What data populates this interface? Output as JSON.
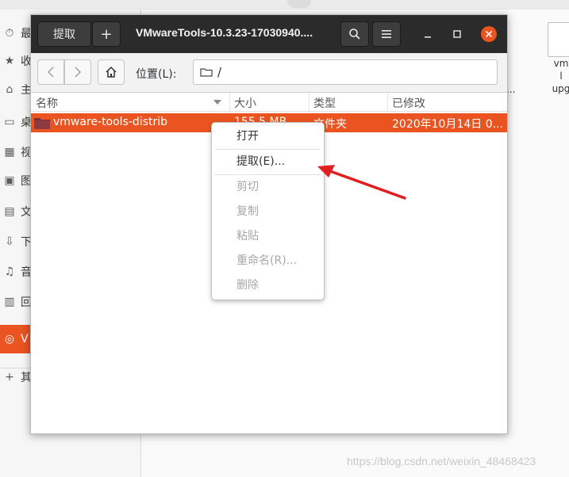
{
  "sidebar": {
    "items": [
      {
        "label": "最",
        "icon": "clock-icon",
        "glyph": "⏱"
      },
      {
        "label": "收",
        "icon": "star-icon",
        "glyph": "★"
      },
      {
        "label": "主",
        "icon": "home-icon",
        "glyph": "⌂"
      },
      {
        "label": "桌",
        "icon": "desktop-icon",
        "glyph": "▭"
      },
      {
        "label": "视",
        "icon": "video-icon",
        "glyph": "▦"
      },
      {
        "label": "图",
        "icon": "picture-icon",
        "glyph": "▣"
      },
      {
        "label": "文",
        "icon": "document-icon",
        "glyph": "▤"
      },
      {
        "label": "下",
        "icon": "download-icon",
        "glyph": "⇩"
      },
      {
        "label": "音",
        "icon": "music-icon",
        "glyph": "♫"
      },
      {
        "label": "回",
        "icon": "trash-icon",
        "glyph": "▥"
      },
      {
        "label": "V",
        "icon": "disc-icon",
        "glyph": "◎",
        "active": true
      },
      {
        "label": "其",
        "icon": "plus-icon",
        "glyph": "+"
      }
    ]
  },
  "background": {
    "file_right_label": "vm\nl\nupg",
    "dots": "..."
  },
  "dialog": {
    "extract_button": "提取",
    "add_button": "+",
    "title": "VMwareTools-10.3.23-17030940....",
    "search_icon": "search-icon",
    "menu_icon": "hamburger-icon",
    "minimize_icon": "minimize-icon",
    "maximize_icon": "maximize-icon",
    "close_icon": "close-icon",
    "location_label": "位置(L):",
    "location_path": "/",
    "columns": {
      "name": "名称",
      "size": "大小",
      "type": "类型",
      "modified": "已修改"
    },
    "row": {
      "name": "vmware-tools-distrib",
      "size": "155.5 MB",
      "type": "文件夹",
      "modified": "2020年10月14日 0..."
    }
  },
  "context_menu": {
    "items": [
      {
        "label": "打开",
        "enabled": true
      },
      {
        "label": "提取(E)...",
        "enabled": true
      },
      {
        "label": "剪切",
        "enabled": false
      },
      {
        "label": "复制",
        "enabled": false
      },
      {
        "label": "粘贴",
        "enabled": false
      },
      {
        "label": "重命名(R)...",
        "enabled": false
      },
      {
        "label": "删除",
        "enabled": false
      }
    ]
  },
  "watermark": "https://blog.csdn.net/weixin_48468423",
  "colors": {
    "accent": "#e95420",
    "titlebar": "#2b2b2b",
    "annotation_arrow": "#e02020"
  }
}
